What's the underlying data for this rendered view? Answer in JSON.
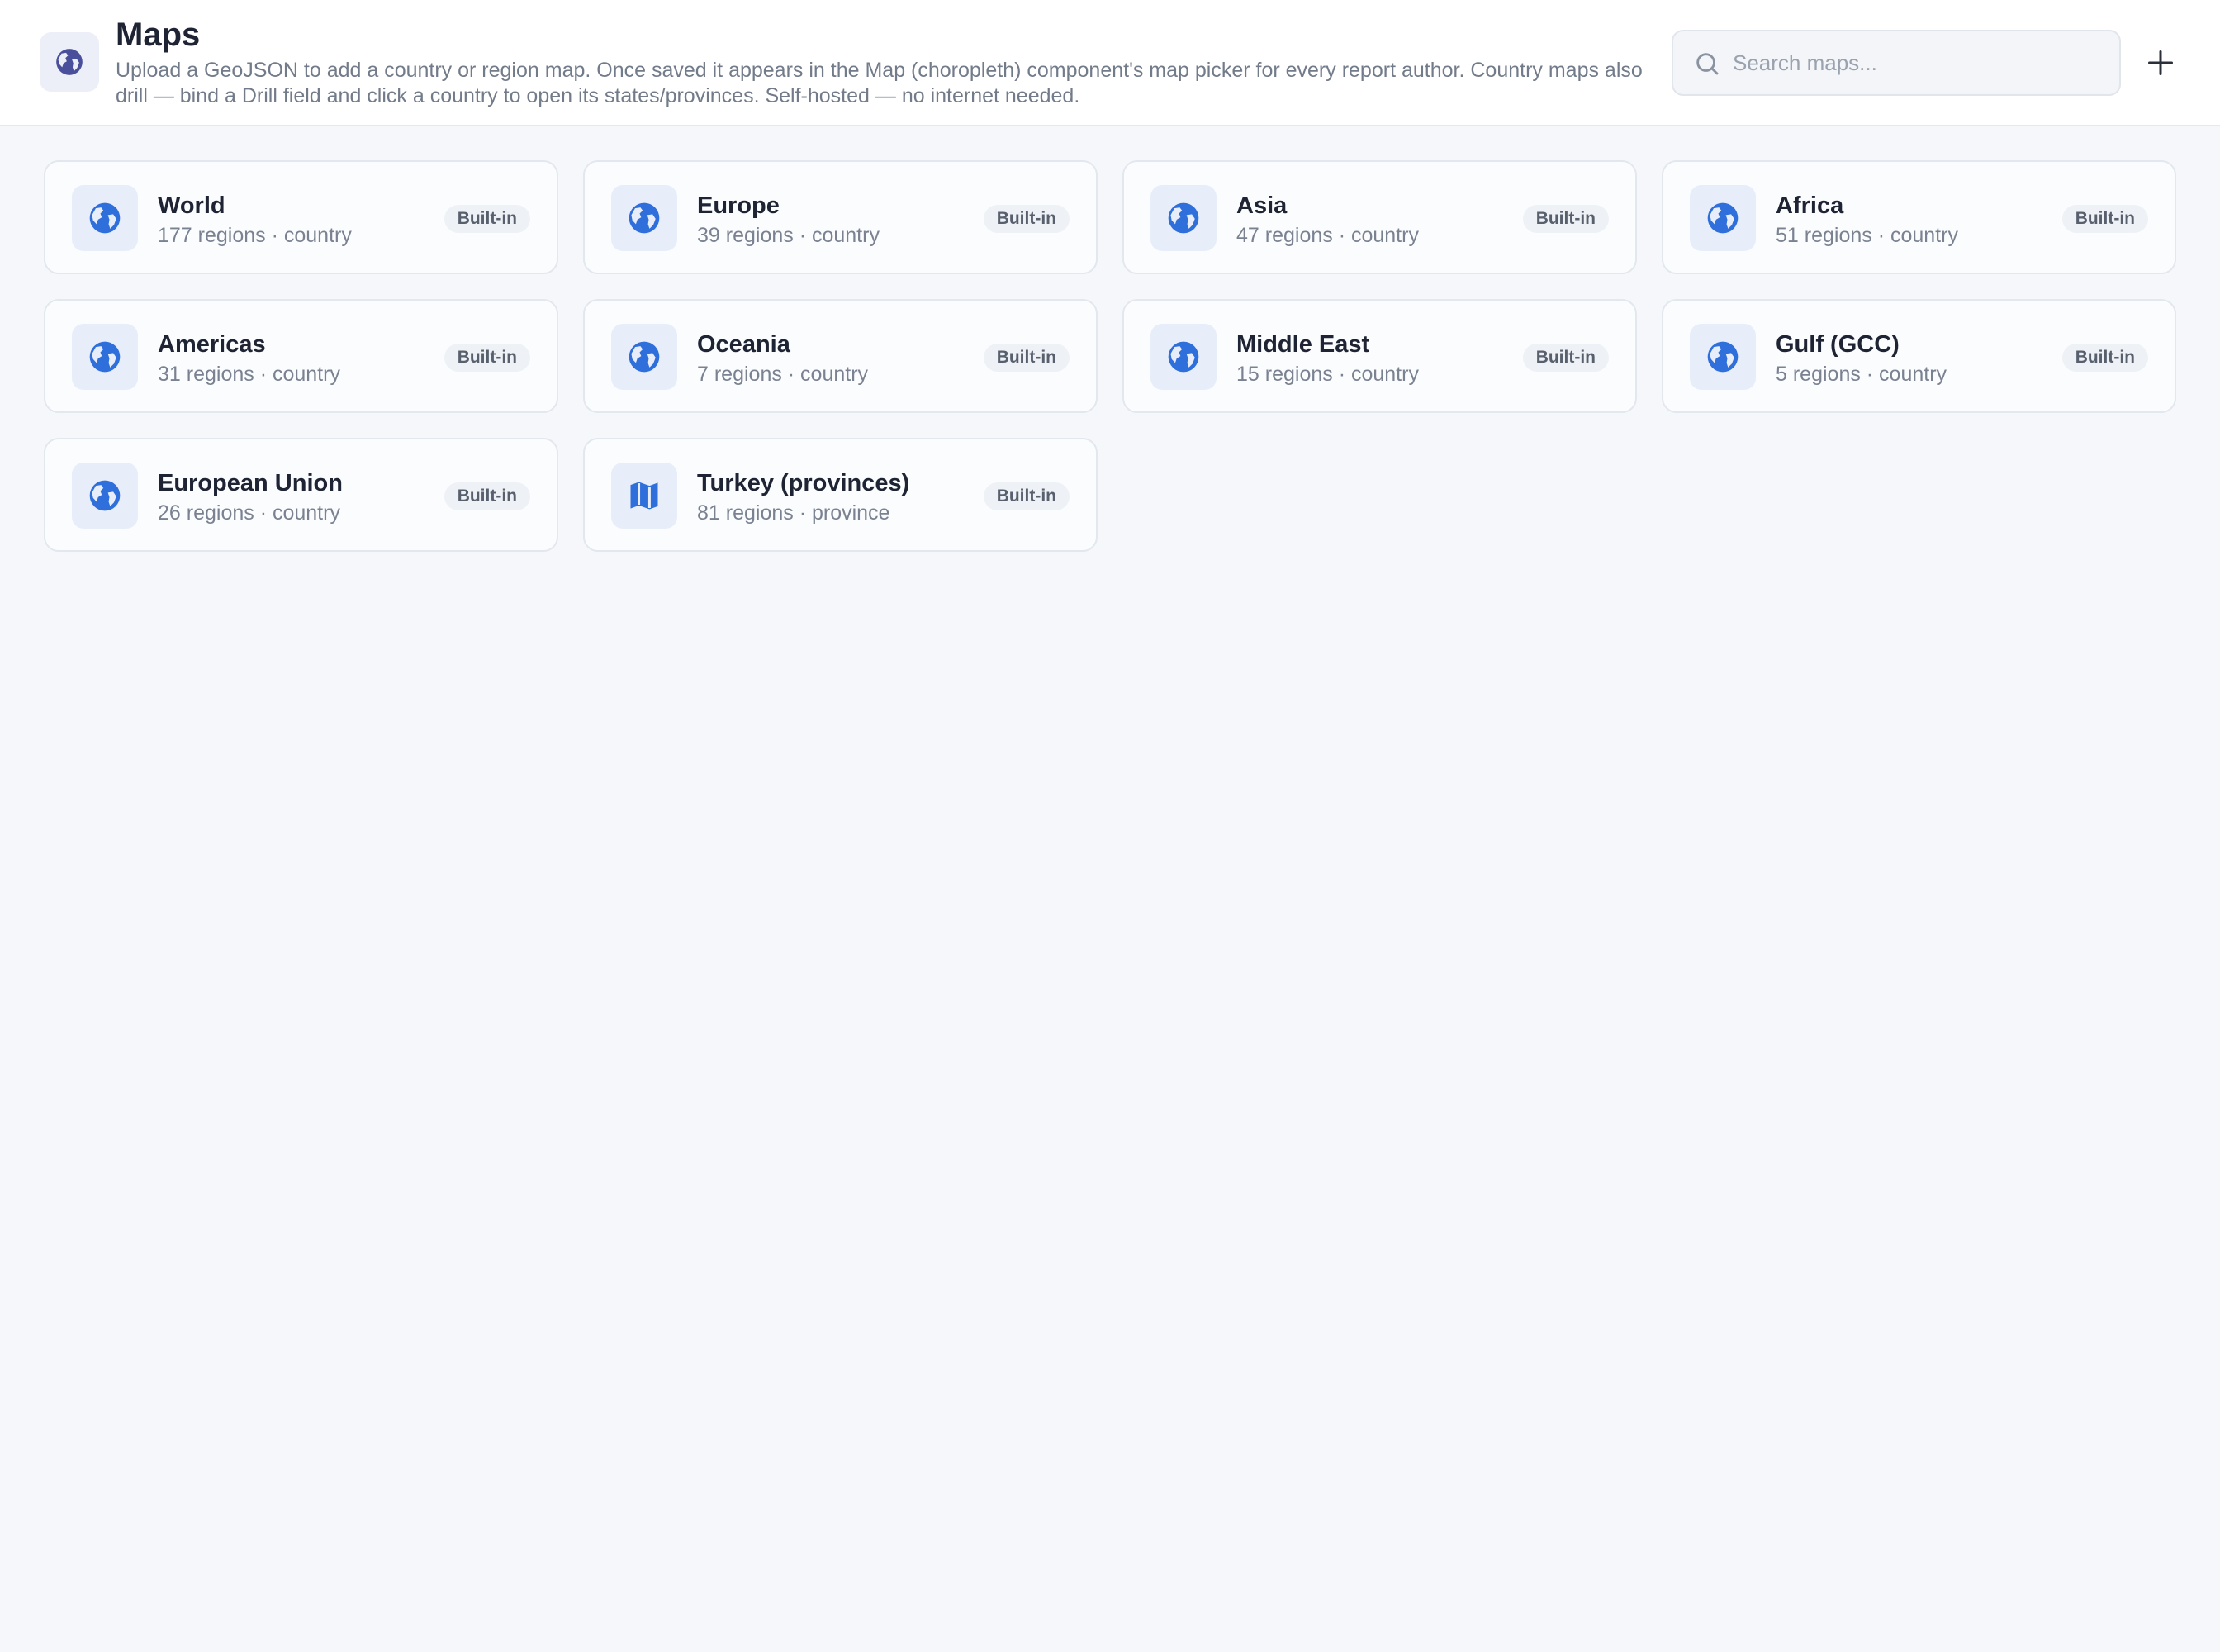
{
  "header": {
    "icon": "globe-icon",
    "title": "Maps",
    "description": "Upload a GeoJSON to add a country or region map. Once saved it appears in the Map (choropleth) component's map picker for every report author. Country maps also drill — bind a Drill field and click a country to open its states/provinces. Self-hosted — no internet needed.",
    "search_placeholder": "Search maps...",
    "search_value": "",
    "add_icon": "plus-icon"
  },
  "colors": {
    "accent": "#2f6fdc",
    "header_icon": "#4a4f9c",
    "badge_bg": "#eef1f5"
  },
  "maps": [
    {
      "name": "World",
      "subtitle": "177 regions · country",
      "badge": "Built-in",
      "icon": "globe-icon"
    },
    {
      "name": "Europe",
      "subtitle": "39 regions · country",
      "badge": "Built-in",
      "icon": "globe-icon"
    },
    {
      "name": "Asia",
      "subtitle": "47 regions · country",
      "badge": "Built-in",
      "icon": "globe-icon"
    },
    {
      "name": "Africa",
      "subtitle": "51 regions · country",
      "badge": "Built-in",
      "icon": "globe-icon"
    },
    {
      "name": "Americas",
      "subtitle": "31 regions · country",
      "badge": "Built-in",
      "icon": "globe-icon"
    },
    {
      "name": "Oceania",
      "subtitle": "7 regions · country",
      "badge": "Built-in",
      "icon": "globe-icon"
    },
    {
      "name": "Middle East",
      "subtitle": "15 regions · country",
      "badge": "Built-in",
      "icon": "globe-icon"
    },
    {
      "name": "Gulf (GCC)",
      "subtitle": "5 regions · country",
      "badge": "Built-in",
      "icon": "globe-icon"
    },
    {
      "name": "European Union",
      "subtitle": "26 regions · country",
      "badge": "Built-in",
      "icon": "globe-icon"
    },
    {
      "name": "Turkey (provinces)",
      "subtitle": "81 regions · province",
      "badge": "Built-in",
      "icon": "folded-map-icon"
    }
  ]
}
